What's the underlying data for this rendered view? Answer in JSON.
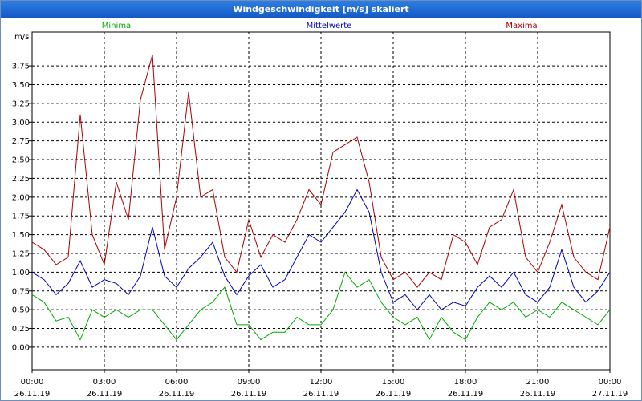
{
  "window": {
    "title": "Windgeschwindigkeit [m/s] skaliert"
  },
  "colors": {
    "min": "#00aa00",
    "mean": "#0000bb",
    "max": "#aa0000",
    "title_bar": "#1f6fd8"
  },
  "chart_data": {
    "type": "line",
    "title": "Windgeschwindigkeit [m/s] skaliert",
    "ylabel": "m/s",
    "xlabel": "",
    "ylim": [
      -0.3,
      4.2
    ],
    "xlim": [
      0,
      24
    ],
    "grid": true,
    "legend_placement": "top",
    "y_ticks": [
      "0,00",
      "0,25",
      "0,50",
      "0,75",
      "1,00",
      "1,25",
      "1,50",
      "1,75",
      "2,00",
      "2,25",
      "2,50",
      "2,75",
      "3,00",
      "3,25",
      "3,50",
      "3,75"
    ],
    "x_ticks": [
      {
        "time": "00:00",
        "date": "26.11.19"
      },
      {
        "time": "03:00",
        "date": "26.11.19"
      },
      {
        "time": "06:00",
        "date": "26.11.19"
      },
      {
        "time": "09:00",
        "date": "26.11.19"
      },
      {
        "time": "12:00",
        "date": "26.11.19"
      },
      {
        "time": "15:00",
        "date": "26.11.19"
      },
      {
        "time": "18:00",
        "date": "26.11.19"
      },
      {
        "time": "21:00",
        "date": "26.11.19"
      },
      {
        "time": "00:00",
        "date": "27.11.19"
      }
    ],
    "x_values_hours": [
      0,
      0.5,
      1,
      1.5,
      2,
      2.5,
      3,
      3.5,
      4,
      4.5,
      5,
      5.5,
      6,
      6.5,
      7,
      7.5,
      8,
      8.5,
      9,
      9.5,
      10,
      10.5,
      11,
      11.5,
      12,
      12.5,
      13,
      13.5,
      14,
      14.5,
      15,
      15.5,
      16,
      16.5,
      17,
      17.5,
      18,
      18.5,
      19,
      19.5,
      20,
      20.5,
      21,
      21.5,
      22,
      22.5,
      23,
      23.5,
      24
    ],
    "series": [
      {
        "name": "Minima",
        "color": "#00aa00",
        "values": [
          0.7,
          0.6,
          0.35,
          0.4,
          0.1,
          0.5,
          0.4,
          0.5,
          0.4,
          0.5,
          0.5,
          0.3,
          0.1,
          0.3,
          0.5,
          0.6,
          0.8,
          0.3,
          0.3,
          0.1,
          0.2,
          0.2,
          0.4,
          0.3,
          0.3,
          0.5,
          1.0,
          0.8,
          0.9,
          0.6,
          0.4,
          0.3,
          0.4,
          0.1,
          0.4,
          0.2,
          0.1,
          0.4,
          0.6,
          0.5,
          0.6,
          0.4,
          0.5,
          0.4,
          0.6,
          0.5,
          0.4,
          0.3,
          0.5
        ]
      },
      {
        "name": "Mittelwerte",
        "color": "#0000bb",
        "values": [
          1.0,
          0.9,
          0.7,
          0.85,
          1.15,
          0.8,
          0.9,
          0.85,
          0.7,
          0.95,
          1.6,
          0.95,
          0.8,
          1.05,
          1.2,
          1.4,
          0.95,
          0.7,
          0.95,
          1.1,
          0.8,
          0.9,
          1.2,
          1.5,
          1.4,
          1.6,
          1.8,
          2.1,
          1.8,
          1.0,
          0.6,
          0.7,
          0.5,
          0.7,
          0.5,
          0.6,
          0.55,
          0.8,
          0.95,
          0.8,
          1.0,
          0.7,
          0.6,
          0.8,
          1.3,
          0.8,
          0.6,
          0.75,
          1.0
        ]
      },
      {
        "name": "Maxima",
        "color": "#aa0000",
        "values": [
          1.4,
          1.3,
          1.1,
          1.2,
          3.1,
          1.5,
          1.1,
          2.2,
          1.7,
          3.3,
          3.9,
          1.3,
          2.0,
          3.4,
          2.0,
          2.1,
          1.2,
          1.0,
          1.7,
          1.2,
          1.5,
          1.4,
          1.7,
          2.1,
          1.9,
          2.6,
          2.7,
          2.8,
          2.2,
          1.2,
          0.9,
          1.0,
          0.8,
          1.0,
          0.9,
          1.5,
          1.4,
          1.1,
          1.6,
          1.7,
          2.1,
          1.2,
          1.0,
          1.4,
          1.9,
          1.2,
          1.0,
          0.9,
          1.6
        ]
      }
    ]
  }
}
